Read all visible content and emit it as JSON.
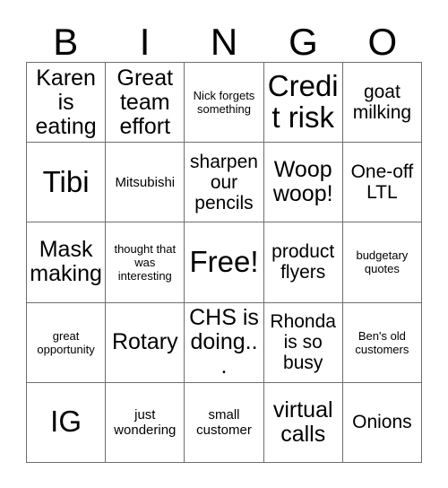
{
  "card": {
    "title": "BINGO",
    "header_letters": [
      "B",
      "I",
      "N",
      "G",
      "O"
    ],
    "columns": [
      {
        "letter": "B",
        "cells": [
          {
            "text": "Karen is eating",
            "size": "lg"
          },
          {
            "text": "Tibi",
            "size": "xl"
          },
          {
            "text": "Mask making",
            "size": "lg"
          },
          {
            "text": "great opportunity",
            "size": "xs"
          },
          {
            "text": "IG",
            "size": "xl"
          }
        ]
      },
      {
        "letter": "I",
        "cells": [
          {
            "text": "Great team effort",
            "size": "lg"
          },
          {
            "text": "Mitsubishi",
            "size": "sm"
          },
          {
            "text": "thought that was interesting",
            "size": "xs"
          },
          {
            "text": "Rotary",
            "size": "lg"
          },
          {
            "text": "just wondering",
            "size": "sm"
          }
        ]
      },
      {
        "letter": "N",
        "cells": [
          {
            "text": "Nick forgets something",
            "size": "xs"
          },
          {
            "text": "sharpen our pencils",
            "size": "md"
          },
          {
            "text": "Free!",
            "size": "xl"
          },
          {
            "text": "CHS is doing...",
            "size": "lg"
          },
          {
            "text": "small customer",
            "size": "sm"
          }
        ]
      },
      {
        "letter": "G",
        "cells": [
          {
            "text": "Credit risk",
            "size": "xl"
          },
          {
            "text": "Woop woop!",
            "size": "lg"
          },
          {
            "text": "product flyers",
            "size": "md"
          },
          {
            "text": "Rhonda is so busy",
            "size": "md"
          },
          {
            "text": "virtual calls",
            "size": "lg"
          }
        ]
      },
      {
        "letter": "O",
        "cells": [
          {
            "text": "goat milking",
            "size": "md"
          },
          {
            "text": "One-off LTL",
            "size": "md"
          },
          {
            "text": "budgetary quotes",
            "size": "xs"
          },
          {
            "text": "Ben's old customers",
            "size": "xs"
          },
          {
            "text": "Onions",
            "size": "md"
          }
        ]
      }
    ],
    "free_space": {
      "row": 2,
      "column": 2,
      "label": "Free!"
    },
    "colors": {
      "background": "#ffffff",
      "text": "#000000",
      "grid_line": "#6e6e6e"
    }
  }
}
